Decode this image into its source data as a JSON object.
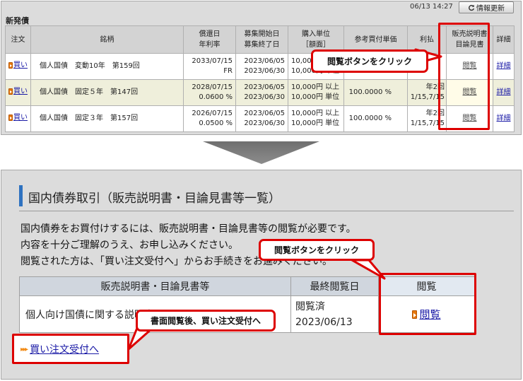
{
  "top": {
    "timestamp": "06/13 14:27",
    "refresh_label": "情報更新",
    "section_title": "新発債",
    "headers": {
      "order": "注文",
      "name": "銘柄",
      "redemption_1": "償還日",
      "redemption_2": "年利率",
      "recruit_1": "募集開始日",
      "recruit_2": "募集終了日",
      "unit_1": "購入単位",
      "unit_2": "［額面］",
      "ref_price": "参考買付単価",
      "interest": "利払",
      "docs_1": "販売説明書",
      "docs_2": "目論見書",
      "detail": "詳細"
    },
    "rows": [
      {
        "buy": "買い",
        "name": "個人国債　変動10年　第159回",
        "red_date": "2033/07/15",
        "red_rate": "FR",
        "start": "2023/06/05",
        "end": "2023/06/30",
        "unit_1": "10,000円 以上",
        "unit_2": "10,000円 単位",
        "ref": "",
        "int_1": "",
        "int_2": "",
        "view": "閲覧",
        "detail": "詳細"
      },
      {
        "buy": "買い",
        "name": "個人国債　固定５年　第147回",
        "red_date": "2028/07/15",
        "red_rate": "0.0600 %",
        "start": "2023/06/05",
        "end": "2023/06/30",
        "unit_1": "10,000円 以上",
        "unit_2": "10,000円 単位",
        "ref": "100.0000 %",
        "int_1": "年2回",
        "int_2": "1/15,7/15",
        "view": "閲覧",
        "detail": "詳細"
      },
      {
        "buy": "買い",
        "name": "個人国債　固定３年　第157回",
        "red_date": "2026/07/15",
        "red_rate": "0.0500 %",
        "start": "2023/06/05",
        "end": "2023/06/30",
        "unit_1": "10,000円 以上",
        "unit_2": "10,000円 単位",
        "ref": "100.0000 %",
        "int_1": "年2回",
        "int_2": "1/15,7/15",
        "view": "閲覧",
        "detail": "詳細"
      }
    ],
    "callout": "閲覧ボタンをクリック"
  },
  "bottom": {
    "title": "国内債券取引（販売説明書・目論見書等一覧）",
    "instructions": [
      "国内債券をお買付けするには、販売説明書・目論見書等の閲覧が必要です。",
      "内容を十分ご理解のうえ、お申し込みください。",
      "閲覧された方は、「買い注文受付へ」からお手続きをお進みください。"
    ],
    "table_headers": {
      "docs": "販売説明書・目論見書等",
      "last_viewed": "最終閲覧日",
      "view": "閲覧"
    },
    "row": {
      "doc": "個人向け国債に関する説明書",
      "status": "閲覧済",
      "date": "2023/06/13",
      "view": "閲覧"
    },
    "callout_view": "閲覧ボタンをクリック",
    "callout_order": "書面閲覧後、買い注文受付へ",
    "order_link": "買い注文受付へ"
  },
  "colors": {
    "highlight": "#dd0000",
    "link": "#1a1aa6",
    "title_bar": "#2e72c0",
    "icon": "#e6780d"
  },
  "icons": {
    "refresh": "refresh-icon",
    "buy": "orange-arrow-icon",
    "order": "triple-chevron-icon"
  }
}
